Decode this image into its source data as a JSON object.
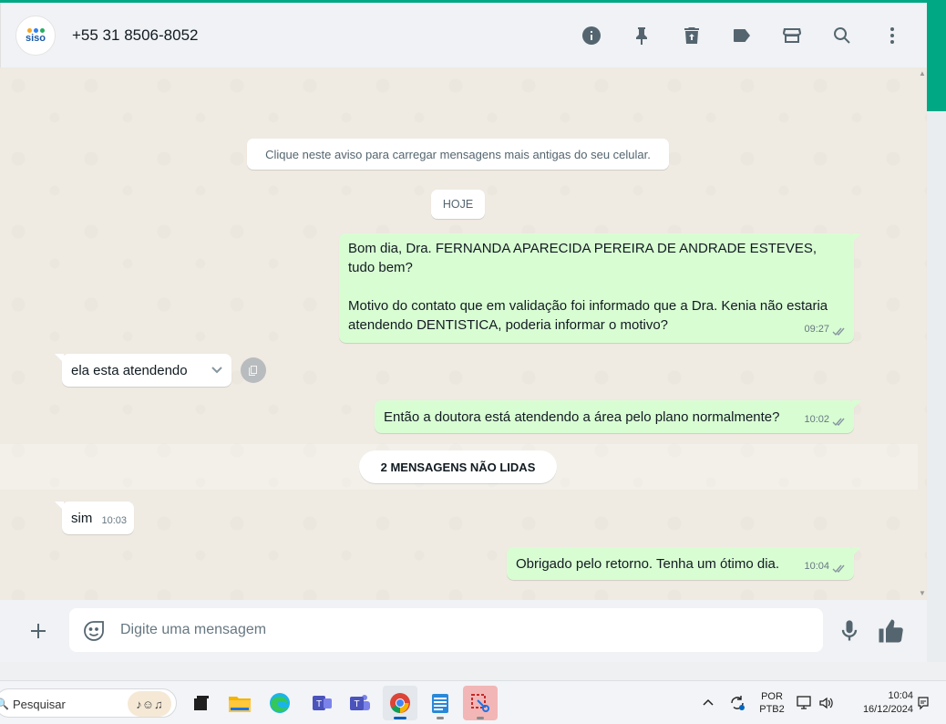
{
  "colors": {
    "accent": "#00a884",
    "outgoing_bubble": "#d9fdd3",
    "incoming_bubble": "#ffffff",
    "chat_background": "#efeae2",
    "header_background": "#f0f2f5",
    "icon_grey": "#54656f"
  },
  "header": {
    "avatar_logo": "siso",
    "contact_name": "+55 31 8506-8052",
    "icons": [
      "info-icon",
      "pin-icon",
      "delete-icon",
      "label-icon",
      "store-icon",
      "search-icon",
      "menu-icon"
    ]
  },
  "chat": {
    "system_note": "Clique neste aviso para carregar mensagens mais antigas do seu celular.",
    "date_chip": "HOJE",
    "unread_banner": "2 MENSAGENS NÃO LIDAS",
    "messages": [
      {
        "direction": "out",
        "text": "Bom dia, Dra. FERNANDA APARECIDA PEREIRA DE ANDRADE ESTEVES, tudo bem?\n\nMotivo do contato que em validação foi informado que a Dra. Kenia não estaria atendendo DENTISTICA, poderia informar o motivo?",
        "time": "09:27",
        "status": "read"
      },
      {
        "direction": "in",
        "text": "ela esta atendendo",
        "time": "",
        "status": ""
      },
      {
        "direction": "out",
        "text": "Então a doutora está atendendo a área pelo plano normalmente?",
        "time": "10:02",
        "status": "read"
      },
      {
        "direction": "in",
        "text": "sim",
        "time": "10:03",
        "status": ""
      },
      {
        "direction": "out",
        "text": "Obrigado pelo retorno. Tenha um ótimo dia.",
        "time": "10:04",
        "status": "read"
      }
    ]
  },
  "composer": {
    "placeholder": "Digite uma mensagem",
    "value": ""
  },
  "taskbar": {
    "search_label": "Pesquisar",
    "apps": [
      "task-view-icon",
      "file-explorer-icon",
      "edge-icon",
      "teams-work-icon",
      "teams-icon",
      "chrome-icon",
      "notepad-icon",
      "snipping-tool-icon"
    ],
    "active_app": "chrome-icon",
    "language": "POR",
    "keyboard_layout": "PTB2",
    "time": "10:04",
    "date": "16/12/2024"
  }
}
